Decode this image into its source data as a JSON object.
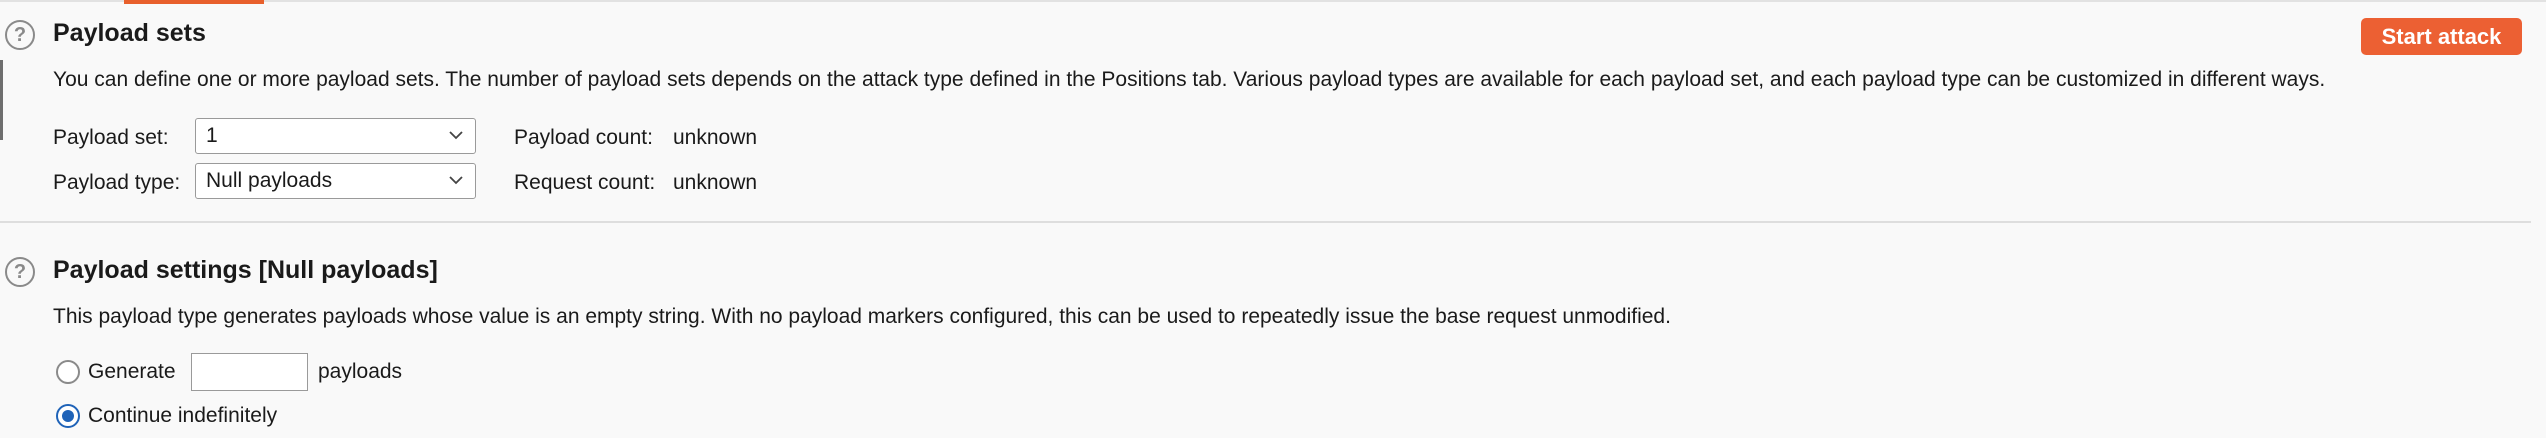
{
  "payload_sets": {
    "title": "Payload sets",
    "start_button": "Start attack",
    "description": "You can define one or more payload sets. The number of payload sets depends on the attack type defined in the Positions tab. Various payload types are available for each payload set, and each payload type can be customized in different ways.",
    "set_label": "Payload set:",
    "set_value": "1",
    "type_label": "Payload type:",
    "type_value": "Null payloads",
    "payload_count_label": "Payload count:",
    "payload_count_value": "unknown",
    "request_count_label": "Request count:",
    "request_count_value": "unknown"
  },
  "payload_settings": {
    "title": "Payload settings [Null payloads]",
    "description": "This payload type generates payloads whose value is an empty string. With no payload markers configured, this can be used to repeatedly issue the base request unmodified.",
    "generate_label": "Generate",
    "generate_value": "",
    "payloads_label": "payloads",
    "continue_label": "Continue indefinitely",
    "selected_option": "Continue indefinitely"
  },
  "colors": {
    "accent": "#ec6033",
    "radio_selected": "#1f63b8"
  },
  "icons": {
    "help": "help-icon",
    "dropdown": "chevron-down-icon"
  }
}
